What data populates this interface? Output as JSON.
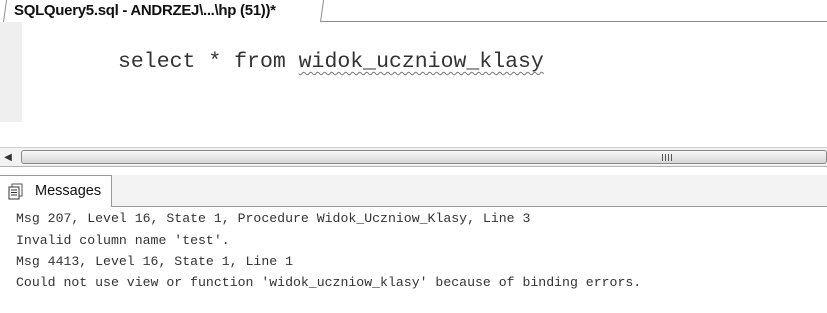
{
  "document_tab": {
    "title": "SQLQuery5.sql - ANDRZEJ\\...\\hp (51))*"
  },
  "editor": {
    "code_keyword_select": "select",
    "code_star": "*",
    "code_keyword_from": "from",
    "code_identifier": "widok_uczniow_klasy"
  },
  "scrollbar": {
    "left_arrow_icon": "scroll-left-arrow",
    "grip_icon": "thumb-grip"
  },
  "results": {
    "messages_tab_label": "Messages",
    "messages_tab_icon": "messages-icon",
    "messages": [
      "Msg 207, Level 16, State 1, Procedure Widok_Uczniow_Klasy, Line 3",
      "Invalid column name 'test'.",
      "Msg 4413, Level 16, State 1, Line 1",
      "Could not use view or function 'widok_uczniow_klasy' because of binding errors."
    ]
  }
}
